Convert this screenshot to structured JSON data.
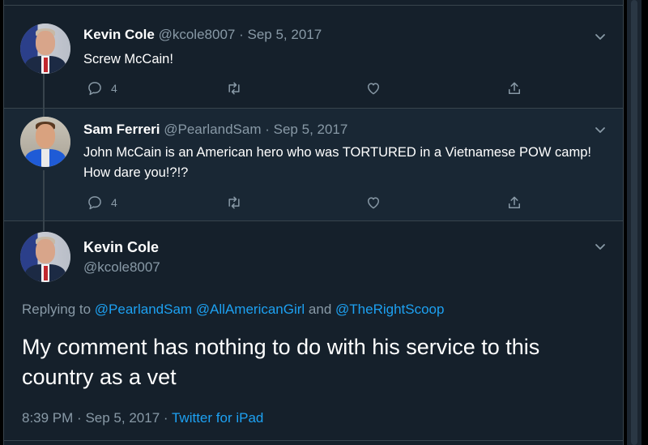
{
  "tweets": [
    {
      "name": "Kevin Cole",
      "handle": "@kcole8007",
      "sep": "·",
      "date": "Sep 5, 2017",
      "text": "Screw McCain!",
      "reply_count": "4"
    },
    {
      "name": "Sam Ferreri",
      "handle": "@PearlandSam",
      "sep": "·",
      "date": "Sep 5, 2017",
      "text": "John McCain is an American hero who was TORTURED in a Vietnamese POW camp!  How dare you!?!?",
      "reply_count": "4"
    }
  ],
  "main": {
    "name": "Kevin Cole",
    "handle": "@kcole8007",
    "replying_prefix": "Replying to",
    "reply_targets": [
      "@PearlandSam",
      "@AllAmericanGirl",
      "@TheRightScoop"
    ],
    "reply_and": "and",
    "text": "My comment has nothing to do with his service to this country as a vet",
    "time": "8:39 PM",
    "sep": "·",
    "date": "Sep 5, 2017",
    "source": "Twitter for iPad"
  },
  "icons": {
    "reply": "reply-icon",
    "retweet": "retweet-icon",
    "like": "like-icon",
    "share": "share-icon",
    "chevron": "chevron-down-icon"
  },
  "colors": {
    "background": "#15202b",
    "highlight_bg": "#192734",
    "link": "#1da1f2",
    "muted": "#8899a6",
    "text": "#ffffff"
  }
}
